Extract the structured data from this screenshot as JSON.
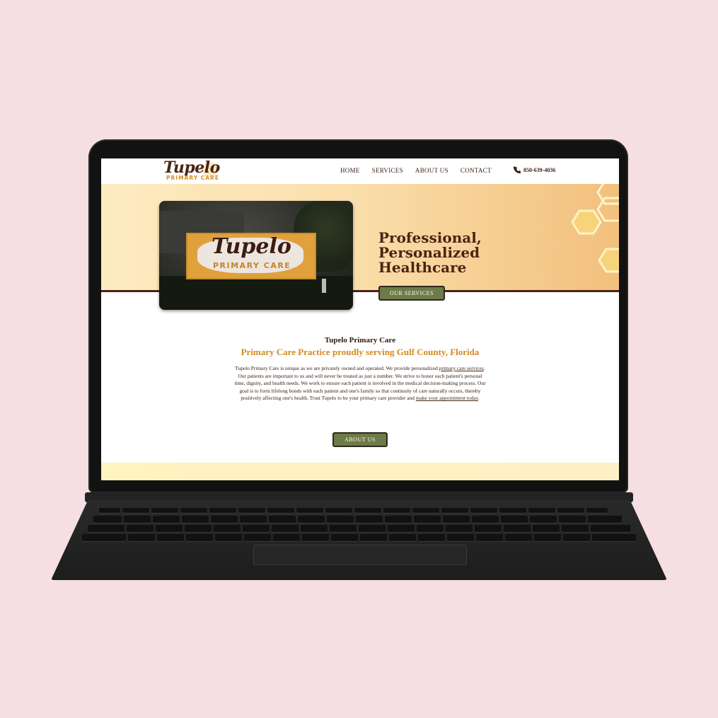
{
  "nav": {
    "logo_script": "Tupelo",
    "logo_sub": "PRIMARY CARE",
    "links": [
      "HOME",
      "SERVICES",
      "ABOUT US",
      "CONTACT"
    ],
    "phone": "850-639-4036"
  },
  "hero": {
    "sign_script": "Tupelo",
    "sign_sub": "PRIMARY CARE",
    "title_line1": "Professional,",
    "title_line2": "Personalized",
    "title_line3": "Healthcare",
    "button_label": "OUR SERVICES"
  },
  "intro": {
    "title": "Tupelo Primary Care",
    "subtitle": "Primary Care Practice proudly serving Gulf County, Florida",
    "body_part1": "Tupelo Primary Care is unique as we are privately owned and operated. We provide personalized ",
    "link1": "primary care services",
    "body_part2": ". Our patients are important to us and will never be treated as just a number. We strive to honor each patient's personal time, dignity, and health needs. We work to ensure each patient is involved in the medical decision-making process. Our goal is to form lifelong bonds with each patient and one's family so that continuity of care naturally occurs, thereby positively affecting one's health. Trust Tupelo to be your primary care provider and ",
    "link2": "make your appointment today",
    "body_part3": ".",
    "button_label": "ABOUT US"
  },
  "colors": {
    "brand_brown": "#4b2314",
    "brand_gold": "#d48a1e",
    "button_green": "#6e7a48",
    "background_pink": "#f5dfe2"
  }
}
